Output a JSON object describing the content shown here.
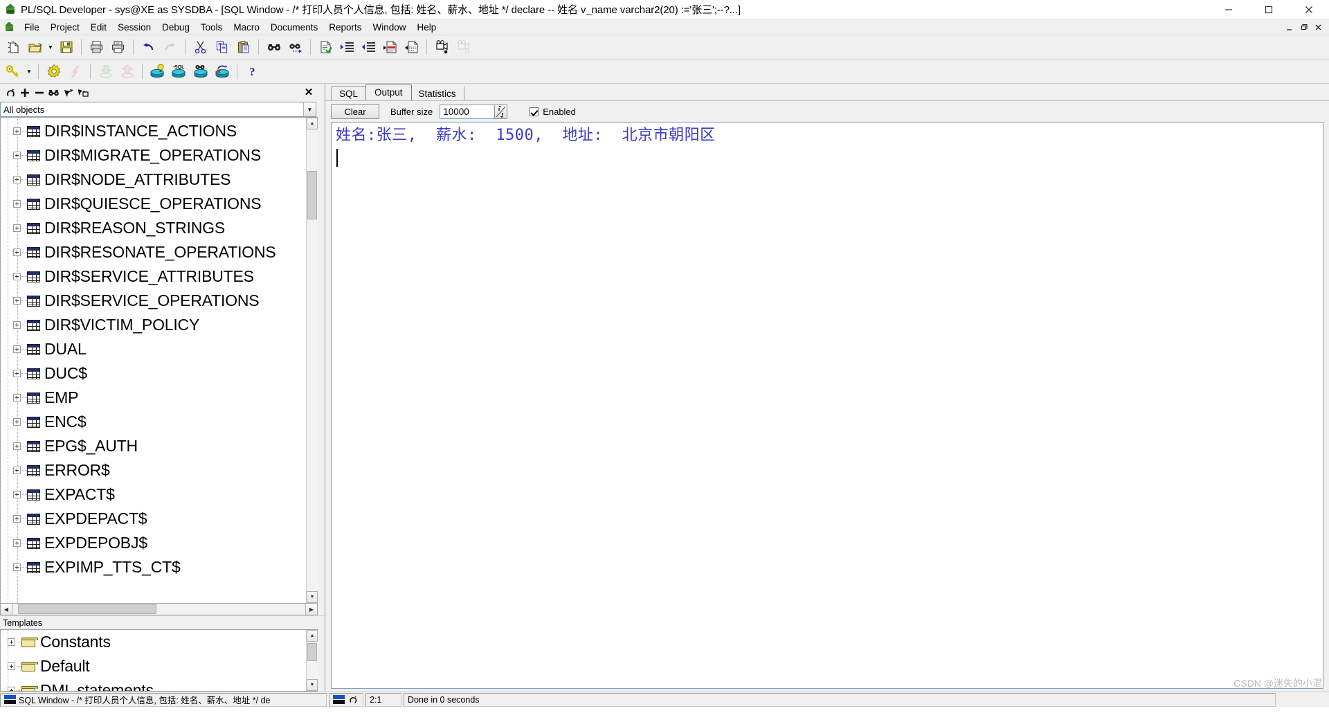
{
  "window": {
    "title": "PL/SQL Developer - sys@XE as SYSDBA - [SQL Window - /* 打印人员个人信息, 包括: 姓名、薪水、地址 */ declare -- 姓名 v_name varchar2(20) :='张三';--?...]",
    "app_icon": "plsql-developer-icon",
    "minimize_label": "Minimize",
    "maximize_label": "Maximize",
    "close_label": "Close"
  },
  "menubar": {
    "icon": "plsql-developer-icon",
    "items": [
      "File",
      "Project",
      "Edit",
      "Session",
      "Debug",
      "Tools",
      "Macro",
      "Documents",
      "Reports",
      "Window",
      "Help"
    ],
    "mdi_buttons": [
      "minimize",
      "restore",
      "close"
    ]
  },
  "toolbar_main": [
    {
      "name": "new-icon",
      "glyph": "new"
    },
    {
      "name": "open-icon",
      "glyph": "open"
    },
    {
      "name": "open-dropdown-arrow-icon",
      "glyph": "arrow"
    },
    {
      "name": "save-icon",
      "glyph": "save"
    },
    {
      "name": "separator",
      "glyph": "sep"
    },
    {
      "name": "print-icon",
      "glyph": "print"
    },
    {
      "name": "print-preview-icon",
      "glyph": "printpreview"
    },
    {
      "name": "separator",
      "glyph": "sep"
    },
    {
      "name": "undo-icon",
      "glyph": "undo"
    },
    {
      "name": "redo-icon",
      "glyph": "redo"
    },
    {
      "name": "separator",
      "glyph": "sep"
    },
    {
      "name": "cut-icon",
      "glyph": "cut"
    },
    {
      "name": "copy-icon",
      "glyph": "copy"
    },
    {
      "name": "paste-icon",
      "glyph": "paste"
    },
    {
      "name": "separator",
      "glyph": "sep"
    },
    {
      "name": "find-icon",
      "glyph": "find"
    },
    {
      "name": "find-next-icon",
      "glyph": "findnext"
    },
    {
      "name": "separator",
      "glyph": "sep"
    },
    {
      "name": "syntax-check-icon",
      "glyph": "syntaxcheck"
    },
    {
      "name": "indent-icon",
      "glyph": "indent"
    },
    {
      "name": "outdent-icon",
      "glyph": "outdent"
    },
    {
      "name": "comment-icon",
      "glyph": "comment"
    },
    {
      "name": "uncomment-icon",
      "glyph": "uncomment"
    },
    {
      "name": "separator",
      "glyph": "sep"
    },
    {
      "name": "record-macro-icon",
      "glyph": "recmacro"
    },
    {
      "name": "play-macro-icon",
      "glyph": "playmacro"
    }
  ],
  "toolbar_secondary": [
    {
      "name": "logon-key-icon",
      "glyph": "key"
    },
    {
      "name": "logon-dropdown-arrow-icon",
      "glyph": "arrow"
    },
    {
      "name": "separator",
      "glyph": "sep"
    },
    {
      "name": "execute-gear-icon",
      "glyph": "gear"
    },
    {
      "name": "break-icon",
      "glyph": "break"
    },
    {
      "name": "separator",
      "glyph": "sep"
    },
    {
      "name": "import-icon",
      "glyph": "import"
    },
    {
      "name": "export-icon",
      "glyph": "export"
    },
    {
      "name": "separator",
      "glyph": "sep"
    },
    {
      "name": "explain-plan-icon",
      "glyph": "bulbdb"
    },
    {
      "name": "sql-db-icon",
      "glyph": "sqldb"
    },
    {
      "name": "find-db-object-icon",
      "glyph": "finddb"
    },
    {
      "name": "rollback-db-icon",
      "glyph": "rollbackdb"
    },
    {
      "name": "separator",
      "glyph": "sep"
    },
    {
      "name": "help-icon",
      "glyph": "help"
    }
  ],
  "browser": {
    "toolbar": [
      {
        "name": "refresh-icon",
        "glyph": "refresh"
      },
      {
        "name": "expand-all-icon",
        "glyph": "plus"
      },
      {
        "name": "collapse-all-icon",
        "glyph": "minus"
      },
      {
        "name": "find-object-icon",
        "glyph": "binoculars"
      },
      {
        "name": "filter-icon",
        "glyph": "filter"
      },
      {
        "name": "folder-filter-icon",
        "glyph": "folderfilter"
      }
    ],
    "close_label": "✕",
    "filter": {
      "value": "All objects",
      "placeholder": "All objects"
    },
    "items": [
      "DIR$INSTANCE_ACTIONS",
      "DIR$MIGRATE_OPERATIONS",
      "DIR$NODE_ATTRIBUTES",
      "DIR$QUIESCE_OPERATIONS",
      "DIR$REASON_STRINGS",
      "DIR$RESONATE_OPERATIONS",
      "DIR$SERVICE_ATTRIBUTES",
      "DIR$SERVICE_OPERATIONS",
      "DIR$VICTIM_POLICY",
      "DUAL",
      "DUC$",
      "EMP",
      "ENC$",
      "EPG$_AUTH",
      "ERROR$",
      "EXPACT$",
      "EXPDEPACT$",
      "EXPDEPOBJ$",
      "EXPIMP_TTS_CT$"
    ]
  },
  "templates": {
    "header": "Templates",
    "items": [
      "Constants",
      "Default",
      "DML statements"
    ]
  },
  "tabs": [
    {
      "label": "SQL",
      "active": false
    },
    {
      "label": "Output",
      "active": true
    },
    {
      "label": "Statistics",
      "active": false
    }
  ],
  "output_toolbar": {
    "clear_label": "Clear",
    "buffer_label": "Buffer size",
    "buffer_value": "10000",
    "spinner_icon": "spinner-updown-icon",
    "enabled_label": "Enabled",
    "enabled_checked": true
  },
  "output": {
    "text": "姓名:张三,  薪水:  1500,  地址:  北京市朝阳区",
    "color": "#3a3ac8"
  },
  "statusbar": {
    "document": "SQL Window - /* 打印人员个人信息, 包括: 姓名、薪水、地址 */ de",
    "connection_icon": "connection-status-icon",
    "refresh_icon": "refresh-green-icon",
    "position": "2:1",
    "message": "Done in 0 seconds"
  },
  "watermark": "CSDN @迷失的小混"
}
